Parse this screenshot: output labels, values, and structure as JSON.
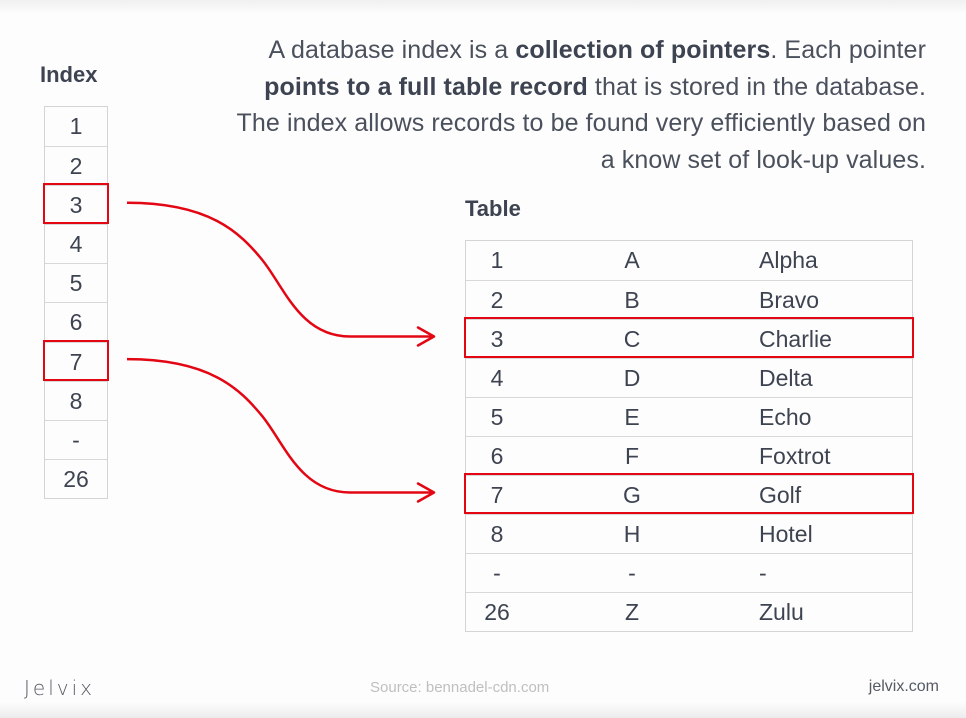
{
  "description": {
    "segments": [
      {
        "text": "A database index is a ",
        "bold": false
      },
      {
        "text": "collection of pointers",
        "bold": true
      },
      {
        "text": ". Each pointer ",
        "bold": false
      },
      {
        "text": "points to a full table record",
        "bold": true
      },
      {
        "text": " that is stored in the database. The index allows records to be found very efficiently based on a know set of look-up values.",
        "bold": false
      }
    ]
  },
  "index": {
    "title": "Index",
    "values": [
      "1",
      "2",
      "3",
      "4",
      "5",
      "6",
      "7",
      "8",
      "-",
      "26"
    ],
    "highlighted": [
      "3",
      "7"
    ]
  },
  "table": {
    "title": "Table",
    "rows": [
      [
        "1",
        "A",
        "Alpha"
      ],
      [
        "2",
        "B",
        "Bravo"
      ],
      [
        "3",
        "C",
        "Charlie"
      ],
      [
        "4",
        "D",
        "Delta"
      ],
      [
        "5",
        "E",
        "Echo"
      ],
      [
        "6",
        "F",
        "Foxtrot"
      ],
      [
        "7",
        "G",
        "Golf"
      ],
      [
        "8",
        "H",
        "Hotel"
      ],
      [
        "-",
        "-",
        "-"
      ],
      [
        "26",
        "Z",
        "Zulu"
      ]
    ],
    "highlighted": [
      "3",
      "7"
    ]
  },
  "pointers": [
    {
      "from_index": "3",
      "to_row": "3"
    },
    {
      "from_index": "7",
      "to_row": "7"
    }
  ],
  "colors": {
    "highlight": "#e30613",
    "text": "#3d4350",
    "border": "#d4d4d4",
    "source_text": "#bfbfbf"
  },
  "footer": {
    "logo": "Jelvix",
    "source": "Source: bennadel-cdn.com",
    "site": "jelvix.com"
  }
}
